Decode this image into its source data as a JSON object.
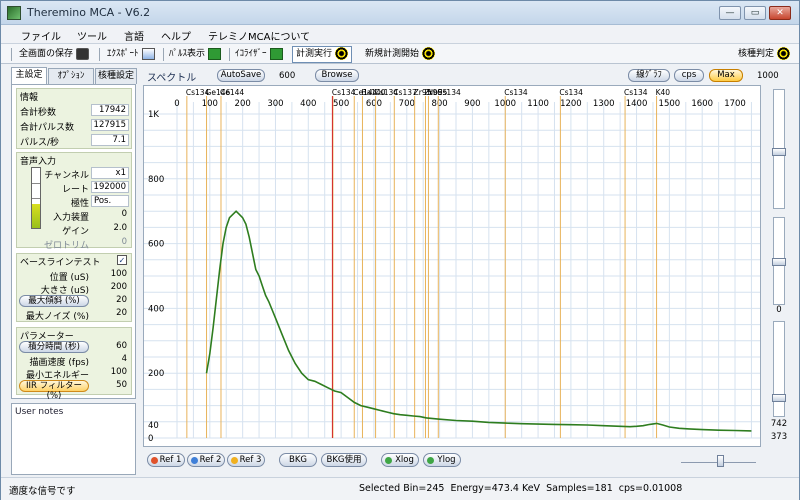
{
  "window": {
    "title": "Theremino MCA - V6.2",
    "min": "—",
    "max": "▭",
    "close": "✕"
  },
  "menu": [
    "ファイル",
    "ツール",
    "言語",
    "ヘルプ",
    "テレミノMCAについて"
  ],
  "toolbar": {
    "save_screen": "全画面の保存",
    "export": "ｴｸｽﾎﾟｰﾄ",
    "pulse_display": "ﾊﾟﾙｽ表示",
    "equalizer": "ｲｺﾗｲｻﾞｰ",
    "run": "計測実行",
    "new_measure": "新規計測開始",
    "nuclide": "核種判定"
  },
  "left_tabs": [
    "主設定",
    "ｵﾌﾟｼｮﾝ",
    "核種設定"
  ],
  "info": {
    "title": "情報",
    "rows": [
      {
        "label": "合計秒数",
        "value": "17942"
      },
      {
        "label": "合計パルス数",
        "value": "127915"
      },
      {
        "label": "パルス/秒",
        "value": "7.1"
      }
    ]
  },
  "audio": {
    "title": "音声入力",
    "rows": [
      {
        "label": "チャンネル",
        "value": "x1"
      },
      {
        "label": "レート",
        "value": "192000"
      },
      {
        "label": "極性",
        "value": "Pos."
      },
      {
        "label": "入力装置",
        "value": "0"
      },
      {
        "label": "ゲイン",
        "value": "2.0"
      },
      {
        "label": "ゼロトリム",
        "value": "0"
      }
    ]
  },
  "baseline": {
    "title": "ベースラインテスト",
    "checked": "✓",
    "rows": [
      {
        "label": "位置 (uS)",
        "value": "100"
      },
      {
        "label": "大きさ (uS)",
        "value": "200"
      },
      {
        "label": "最大傾斜 (%)",
        "value": "20"
      },
      {
        "label": "最大ノイズ (%)",
        "value": "20"
      }
    ]
  },
  "params": {
    "title": "パラメーター",
    "rows": [
      {
        "label": "積分時間 (秒)",
        "value": "60"
      },
      {
        "label": "描画速度 (fps)",
        "value": "4"
      },
      {
        "label": "最小エネルギー",
        "value": "100"
      },
      {
        "label": "IIR フィルター (%)",
        "value": "50"
      }
    ]
  },
  "notes_title": "User notes",
  "spectrum": {
    "title": "スペクトル",
    "autosave": "AutoSave",
    "autosave_value": "600",
    "browse": "Browse",
    "line_graph": "線ｸﾞﾗﾌ",
    "cps": "cps",
    "max": "Max",
    "max_value": "1000"
  },
  "right_values": {
    "mid": "0",
    "v1": "742",
    "v2": "373"
  },
  "bottom_buttons": [
    "Ref 1",
    "Ref 2",
    "Ref 3",
    "BKG",
    "BKG使用",
    "Xlog",
    "Ylog"
  ],
  "bottom_colors": [
    "#e0522b",
    "#3f7fd8",
    "#f0b020",
    "",
    "",
    "#3fa645",
    "#3fa645"
  ],
  "status": {
    "left": "適度な信号です",
    "right": "Selected Bin=245  Energy=473.4 KeV  Samples=181  cps=0.01008"
  },
  "chart_data": {
    "type": "line",
    "x_ticks": [
      "0",
      "100",
      "200",
      "300",
      "400",
      "500",
      "600",
      "700",
      "800",
      "900",
      "1000",
      "1100",
      "1200",
      "1300",
      "1400",
      "1500",
      "1600",
      "1700"
    ],
    "y_ticks": [
      "1K",
      "800",
      "600",
      "400",
      "200",
      "40",
      "0"
    ],
    "xlim": [
      0,
      1770
    ],
    "ylim": [
      0,
      1000
    ],
    "cursor_energy": 473.4,
    "markers": [
      {
        "label": "Cs134",
        "energy": 30
      },
      {
        "label": "Ge146",
        "energy": 90
      },
      {
        "label": "Ce144",
        "energy": 134
      },
      {
        "label": "Cs134",
        "energy": 475
      },
      {
        "label": "Ce144",
        "energy": 540
      },
      {
        "label": "Ba140",
        "energy": 565
      },
      {
        "label": "Cs134",
        "energy": 605
      },
      {
        "label": "Cs137",
        "energy": 662
      },
      {
        "label": "Zr95",
        "energy": 724
      },
      {
        "label": "Zr95",
        "energy": 757
      },
      {
        "label": "Nb95",
        "energy": 766
      },
      {
        "label": "Cs134",
        "energy": 796
      },
      {
        "label": "Cs134",
        "energy": 1000
      },
      {
        "label": "Cs134",
        "energy": 1168
      },
      {
        "label": "Cs134",
        "energy": 1365
      },
      {
        "label": "K40",
        "energy": 1461
      }
    ],
    "series": [
      {
        "x": [
          90,
          100,
          110,
          120,
          130,
          140,
          150,
          160,
          170,
          180,
          190,
          200,
          210,
          220,
          230,
          240,
          250,
          260,
          270,
          280,
          290,
          300,
          320,
          340,
          360,
          380,
          400,
          420,
          440,
          460,
          480,
          500,
          520,
          540,
          560,
          580,
          600,
          620,
          640,
          660,
          680,
          700,
          720,
          740,
          760,
          780,
          800,
          850,
          900,
          950,
          1000,
          1050,
          1100,
          1150,
          1200,
          1250,
          1300,
          1350,
          1380,
          1400,
          1420,
          1440,
          1461,
          1480,
          1500,
          1530,
          1560,
          1600,
          1650,
          1700,
          1750
        ],
        "y": [
          200,
          260,
          340,
          430,
          520,
          600,
          650,
          680,
          690,
          700,
          690,
          680,
          660,
          620,
          570,
          520,
          500,
          470,
          440,
          420,
          395,
          370,
          320,
          270,
          230,
          200,
          180,
          175,
          165,
          155,
          145,
          140,
          125,
          110,
          100,
          95,
          90,
          85,
          80,
          75,
          72,
          70,
          68,
          66,
          62,
          60,
          58,
          54,
          52,
          48,
          46,
          44,
          43,
          42,
          41,
          40,
          38,
          36,
          35,
          36,
          38,
          42,
          45,
          40,
          34,
          30,
          28,
          26,
          24,
          23,
          22
        ]
      }
    ]
  }
}
